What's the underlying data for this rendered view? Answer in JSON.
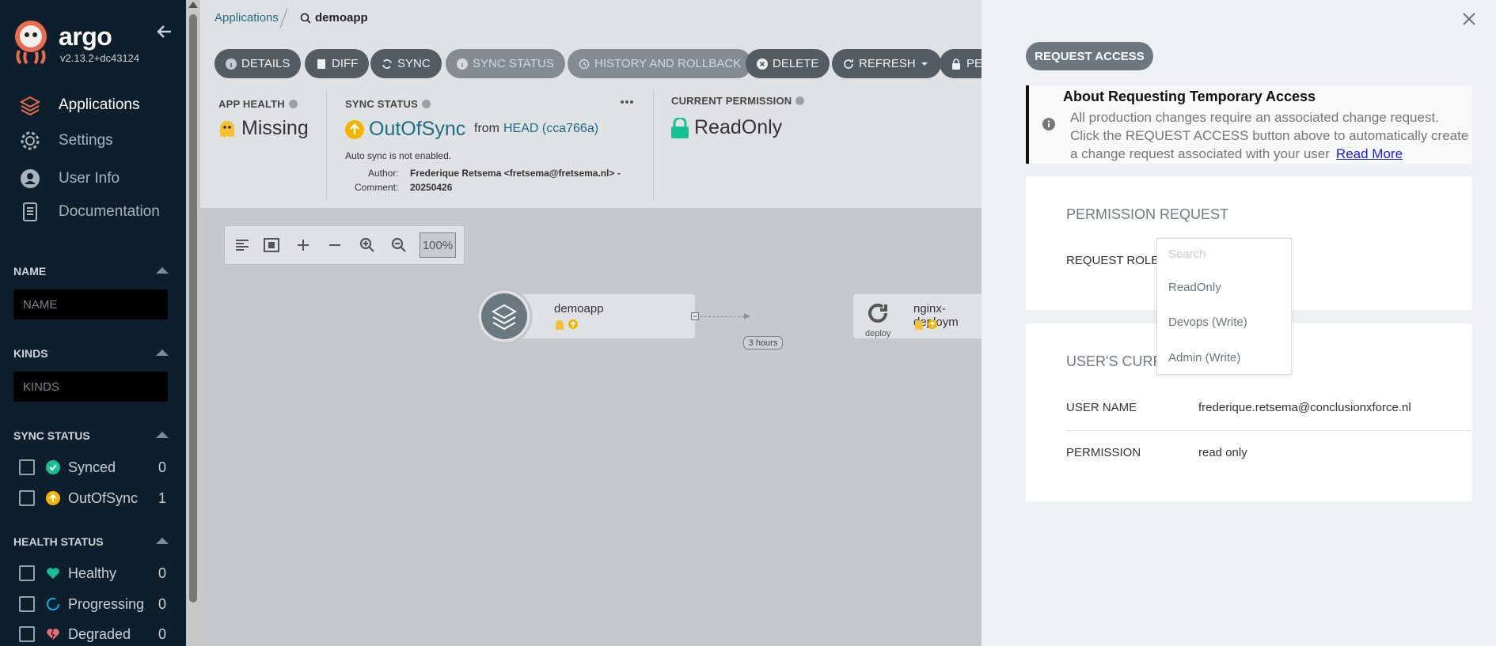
{
  "sidebar": {
    "brand": "argo",
    "version": "v2.13.2+dc43124",
    "nav": [
      "Applications",
      "Settings",
      "User Info",
      "Documentation"
    ],
    "filters": {
      "name_label": "NAME",
      "name_placeholder": "NAME",
      "kinds_label": "KINDS",
      "kinds_placeholder": "KINDS",
      "sync_label": "SYNC STATUS",
      "sync_items": [
        {
          "label": "Synced",
          "count": "0"
        },
        {
          "label": "OutOfSync",
          "count": "1"
        }
      ],
      "health_label": "HEALTH STATUS",
      "health_items": [
        {
          "label": "Healthy",
          "count": "0"
        },
        {
          "label": "Progressing",
          "count": "0"
        },
        {
          "label": "Degraded",
          "count": "0"
        }
      ]
    }
  },
  "breadcrumb": {
    "root": "Applications",
    "current": "demoapp"
  },
  "toolbar": [
    "DETAILS",
    "DIFF",
    "SYNC",
    "SYNC STATUS",
    "HISTORY AND ROLLBACK",
    "DELETE",
    "REFRESH",
    "PER"
  ],
  "status": {
    "app_health_label": "APP HEALTH",
    "app_health_value": "Missing",
    "sync_label": "SYNC STATUS",
    "sync_value": "OutOfSync",
    "sync_from": "from",
    "sync_rev": "HEAD (cca766a)",
    "auto_sync": "Auto sync is not enabled.",
    "author_label": "Author:",
    "author_value": "Frederique Retsema <fretsema@fretsema.nl> -",
    "comment_label": "Comment:",
    "comment_value": "20250426",
    "perm_label": "CURRENT PERMISSION",
    "perm_value": "ReadOnly"
  },
  "graph": {
    "zoom": "100%",
    "app_node": "demoapp",
    "age": "3 hours",
    "deploy_node": "nginx-deploym",
    "deploy_kind": "deploy"
  },
  "panel": {
    "request_button": "REQUEST ACCESS",
    "notice_title": "About Requesting Temporary Access",
    "notice_body": "All production changes require an associated change request. Click the REQUEST ACCESS button above to automatically create a change request associated with your user",
    "notice_link": "Read More",
    "perm_card_title": "PERMISSION REQUEST",
    "request_role_label": "REQUEST ROLE",
    "dropdown_search": "Search",
    "dropdown_options": [
      "ReadOnly",
      "Devops (Write)",
      "Admin (Write)"
    ],
    "user_card_title": "USER'S CURREN",
    "user_name_label": "USER NAME",
    "user_name_value": "frederique.retsema@conclusionxforce.nl",
    "permission_label": "PERMISSION",
    "permission_value": "read only"
  },
  "colors": {
    "accent": "#1e6c86",
    "outofsync": "#f4b400",
    "synced": "#18be94",
    "sidebar": "#0d1f2d"
  }
}
